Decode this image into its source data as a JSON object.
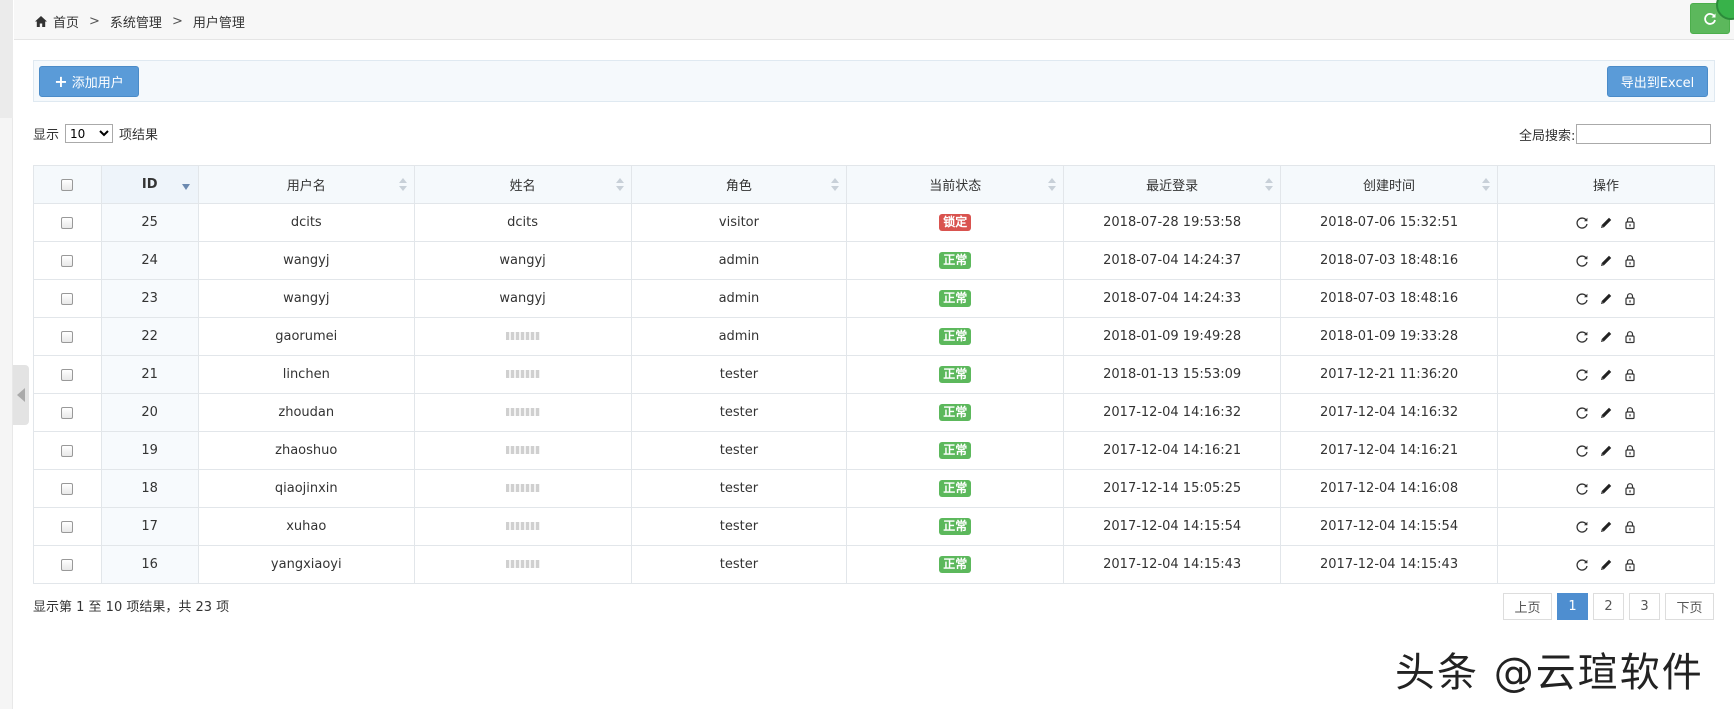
{
  "breadcrumb": {
    "items": [
      "首页",
      "系统管理",
      "用户管理"
    ],
    "separator": ">"
  },
  "toolbar": {
    "add_label": "添加用户",
    "export_label": "导出到Excel"
  },
  "length": {
    "prefix": "显示",
    "value": "10",
    "suffix": "项结果"
  },
  "search": {
    "label": "全局搜索:",
    "value": ""
  },
  "table": {
    "columns": [
      "",
      "ID",
      "用户名",
      "姓名",
      "角色",
      "当前状态",
      "最近登录",
      "创建时间",
      "操作"
    ],
    "rows": [
      {
        "id": "25",
        "username": "dcits",
        "name": "dcits",
        "role": "visitor",
        "status": "锁定",
        "last_login": "2018-07-28 19:53:58",
        "created": "2018-07-06 15:32:51"
      },
      {
        "id": "24",
        "username": "wangyj",
        "name": "wangyj",
        "role": "admin",
        "status": "正常",
        "last_login": "2018-07-04 14:24:37",
        "created": "2018-07-03 18:48:16"
      },
      {
        "id": "23",
        "username": "wangyj",
        "name": "wangyj",
        "role": "admin",
        "status": "正常",
        "last_login": "2018-07-04 14:24:33",
        "created": "2018-07-03 18:48:16"
      },
      {
        "id": "22",
        "username": "gaorumei",
        "name": "",
        "role": "admin",
        "status": "正常",
        "last_login": "2018-01-09 19:49:28",
        "created": "2018-01-09 19:33:28"
      },
      {
        "id": "21",
        "username": "linchen",
        "name": "",
        "role": "tester",
        "status": "正常",
        "last_login": "2018-01-13 15:53:09",
        "created": "2017-12-21 11:36:20"
      },
      {
        "id": "20",
        "username": "zhoudan",
        "name": "",
        "role": "tester",
        "status": "正常",
        "last_login": "2017-12-04 14:16:32",
        "created": "2017-12-04 14:16:32"
      },
      {
        "id": "19",
        "username": "zhaoshuo",
        "name": "",
        "role": "tester",
        "status": "正常",
        "last_login": "2017-12-04 14:16:21",
        "created": "2017-12-04 14:16:21"
      },
      {
        "id": "18",
        "username": "qiaojinxin",
        "name": "",
        "role": "tester",
        "status": "正常",
        "last_login": "2017-12-14 15:05:25",
        "created": "2017-12-04 14:16:08"
      },
      {
        "id": "17",
        "username": "xuhao",
        "name": "",
        "role": "tester",
        "status": "正常",
        "last_login": "2017-12-04 14:15:54",
        "created": "2017-12-04 14:15:54"
      },
      {
        "id": "16",
        "username": "yangxiaoyi",
        "name": "",
        "role": "tester",
        "status": "正常",
        "last_login": "2017-12-04 14:15:43",
        "created": "2017-12-04 14:15:43"
      }
    ]
  },
  "info": "显示第 1 至 10 项结果，共 23 项",
  "pager": {
    "prev": "上页",
    "pages": [
      "1",
      "2",
      "3"
    ],
    "current": "1",
    "next": "下页"
  },
  "watermark": "头条 @云瑄软件",
  "colors": {
    "primary": "#5a9bd8",
    "success": "#5cb85c",
    "danger": "#d9534f"
  },
  "icons": {
    "home": "home-icon",
    "refresh": "refresh-icon",
    "plus": "plus-icon",
    "reset": "reset-icon",
    "edit": "pencil-icon",
    "lock": "lock-icon"
  }
}
